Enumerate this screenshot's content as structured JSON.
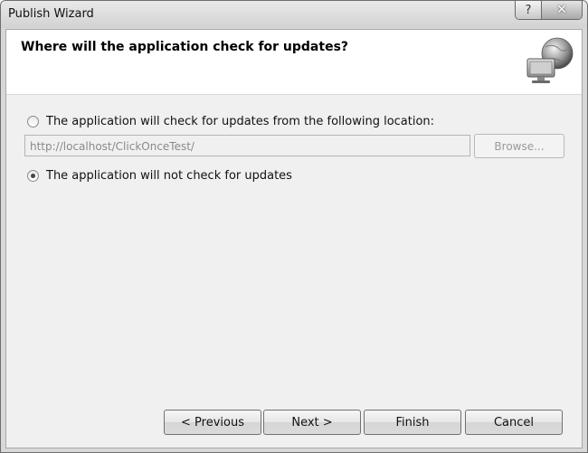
{
  "window": {
    "title": "Publish Wizard",
    "help_glyph": "?",
    "close_glyph": "✕"
  },
  "banner": {
    "heading": "Where will the application check for updates?",
    "icon": "computer-globe-icon"
  },
  "options": {
    "check_location_label": "The application will check for updates from the following location:",
    "check_location_selected": false,
    "url_value": "http://localhost/ClickOnceTest/",
    "browse_label": "Browse...",
    "no_check_label": "The application will not check for updates",
    "no_check_selected": true
  },
  "footer": {
    "previous_label": "< Previous",
    "next_label": "Next >",
    "finish_label": "Finish",
    "cancel_label": "Cancel"
  }
}
